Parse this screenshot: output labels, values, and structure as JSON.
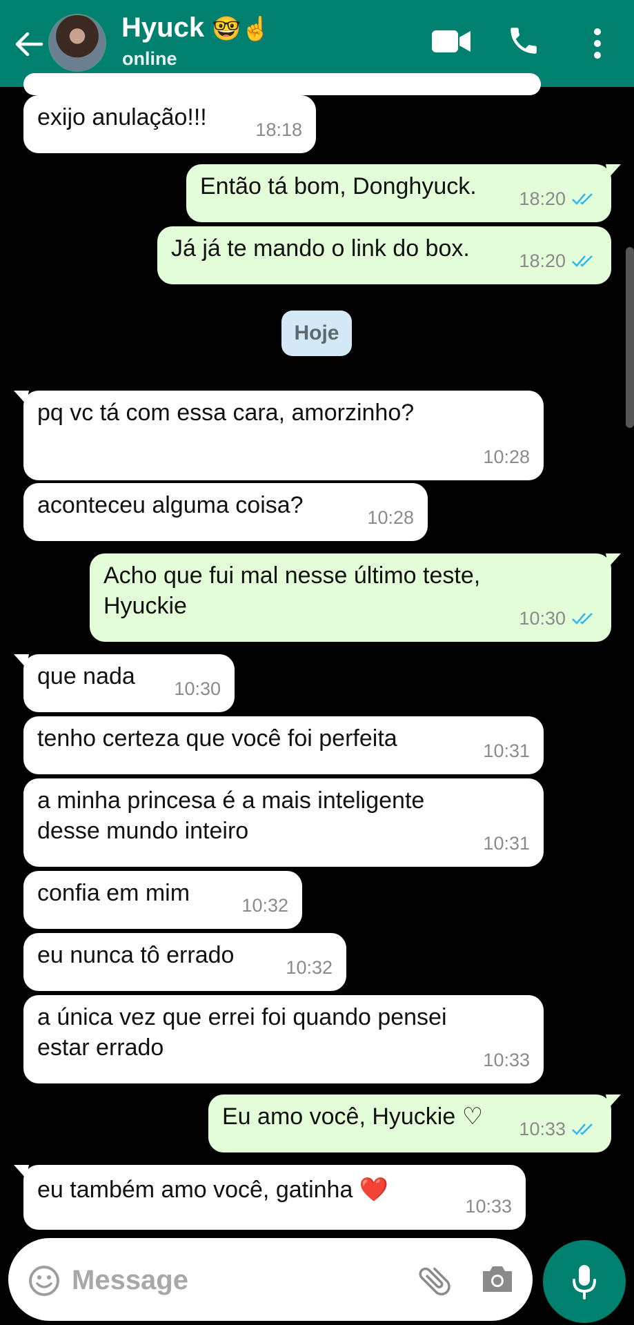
{
  "header": {
    "contact_name": "Hyuck",
    "name_emojis": "🤓☝️",
    "status": "online"
  },
  "day_separator": "Hoje",
  "messages": [
    {
      "dir": "in",
      "text": "exijo anulação!!!",
      "time": "18:18"
    },
    {
      "dir": "out",
      "text": "Então tá bom, Donghyuck.",
      "time": "18:20",
      "read": true
    },
    {
      "dir": "out",
      "text": "Já já te mando o link do box.",
      "time": "18:20",
      "read": true
    },
    {
      "dir": "in",
      "text": "pq vc tá com essa cara, amorzinho?",
      "time": "10:28"
    },
    {
      "dir": "in",
      "text": "aconteceu alguma coisa?",
      "time": "10:28"
    },
    {
      "dir": "out",
      "text": "Acho que fui mal nesse último teste,\nHyuckie",
      "time": "10:30",
      "read": true
    },
    {
      "dir": "in",
      "text": "que nada",
      "time": "10:30"
    },
    {
      "dir": "in",
      "text": "tenho certeza que você foi perfeita",
      "time": "10:31"
    },
    {
      "dir": "in",
      "text": "a minha princesa é a mais inteligente\ndesse mundo inteiro",
      "time": "10:31"
    },
    {
      "dir": "in",
      "text": "confia em mim",
      "time": "10:32"
    },
    {
      "dir": "in",
      "text": "eu nunca tô errado",
      "time": "10:32"
    },
    {
      "dir": "in",
      "text": "a única vez que errei foi quando pensei\nestar errado",
      "time": "10:33"
    },
    {
      "dir": "out",
      "text": "Eu amo você, Hyuckie ♡",
      "time": "10:33",
      "read": true
    },
    {
      "dir": "in",
      "text": "eu também amo você, gatinha ❤️",
      "time": "10:33"
    }
  ],
  "composer": {
    "placeholder": "Message"
  },
  "colors": {
    "header": "#00806f",
    "incoming_bubble": "#ffffff",
    "outgoing_bubble": "#e3fdd8",
    "read_ticks": "#34b7f1",
    "chat_background": "#000000"
  },
  "icons": [
    "back-arrow-icon",
    "video-call-icon",
    "phone-icon",
    "more-options-icon",
    "emoji-icon",
    "attach-icon",
    "camera-icon",
    "mic-icon"
  ]
}
